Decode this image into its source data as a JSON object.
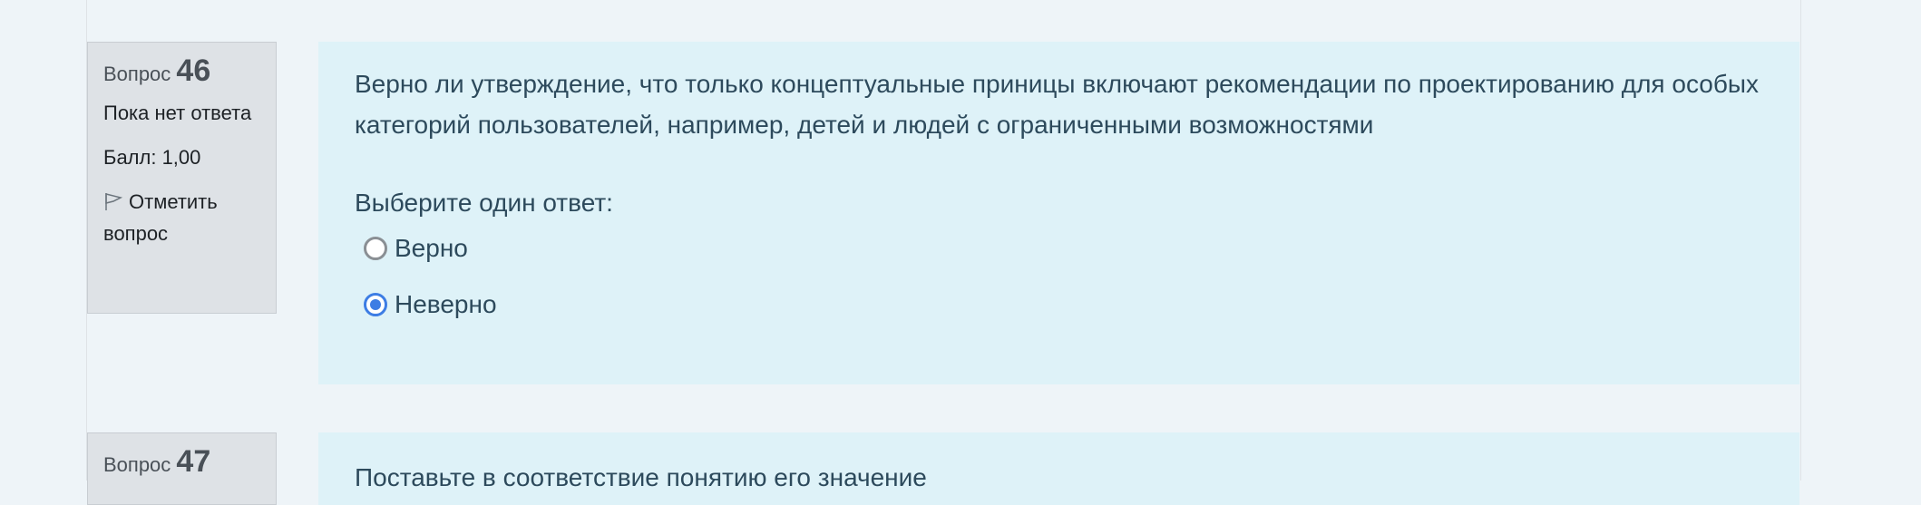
{
  "questions": [
    {
      "label": "Вопрос",
      "number": "46",
      "state": "Пока нет ответа",
      "grade": "Балл: 1,00",
      "flag_label": "Отметить вопрос",
      "text": "Верно ли утверждение, что только концептуальные приницы включают рекомендации по проектированию для  особых категорий пользователей, например, детей и людей с ограниченными возможностями",
      "prompt": "Выберите один ответ:",
      "options": [
        {
          "label": "Верно",
          "selected": false
        },
        {
          "label": "Неверно",
          "selected": true
        }
      ]
    },
    {
      "label": "Вопрос",
      "number": "47",
      "text": "Поставьте в соответствие понятию его значение"
    }
  ],
  "colors": {
    "accent": "#3d7de4",
    "content_bg": "#def2f8",
    "info_bg": "#dee2e6",
    "text": "#2d4a5c"
  }
}
